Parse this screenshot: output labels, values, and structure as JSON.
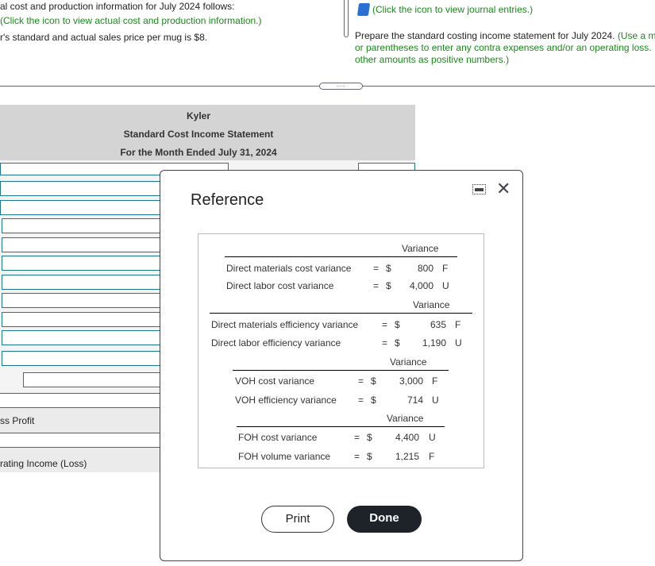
{
  "top_left": {
    "line1": "al cost and production information for July 2024 follows:",
    "line2": "(Click the icon to view actual cost and production information.)",
    "line3": "r's standard and actual sales price per mug is $8."
  },
  "top_right": {
    "journal_link": "(Click the icon to view journal entries.)",
    "instruction": "Prepare the standard costing income statement for July 2024.",
    "note_line1": "(Use a m",
    "note_line2": "or parentheses to enter any contra expenses and/or an operating loss.",
    "note_line3": "other amounts as positive numbers.)",
    "splitter_grip": "......"
  },
  "statement": {
    "company": "Kyler",
    "title": "Standard Cost Income Statement",
    "period": "For the Month Ended July 31, 2024",
    "gross_profit_label": "ss Profit",
    "operating_income_label": "rating Income (Loss)"
  },
  "modal": {
    "title": "Reference",
    "print_label": "Print",
    "done_label": "Done",
    "groups": [
      {
        "header": "Variance",
        "rows": [
          {
            "label": "Direct materials cost variance",
            "eq": "=",
            "cur": "$",
            "amount": "800",
            "type": "F"
          },
          {
            "label": "Direct labor cost variance",
            "eq": "=",
            "cur": "$",
            "amount": "4,000",
            "type": "U"
          }
        ]
      },
      {
        "header": "Variance",
        "rows": [
          {
            "label": "Direct materials efficiency variance",
            "eq": "=",
            "cur": "$",
            "amount": "635",
            "type": "F"
          },
          {
            "label": "Direct labor efficiency variance",
            "eq": "=",
            "cur": "$",
            "amount": "1,190",
            "type": "U"
          }
        ]
      },
      {
        "header": "Variance",
        "rows": [
          {
            "label": "VOH cost variance",
            "eq": "=",
            "cur": "$",
            "amount": "3,000",
            "type": "F"
          },
          {
            "label": "VOH efficiency variance",
            "eq": "=",
            "cur": "$",
            "amount": "714",
            "type": "U"
          }
        ]
      },
      {
        "header": "Variance",
        "rows": [
          {
            "label": "FOH cost variance",
            "eq": "=",
            "cur": "$",
            "amount": "4,400",
            "type": "U"
          },
          {
            "label": "FOH volume variance",
            "eq": "=",
            "cur": "$",
            "amount": "1,215",
            "type": "F"
          }
        ]
      }
    ]
  },
  "colors": {
    "accent": "#1a7a96",
    "link_green": "#1a8a1a",
    "done_bg": "#1e2329"
  }
}
